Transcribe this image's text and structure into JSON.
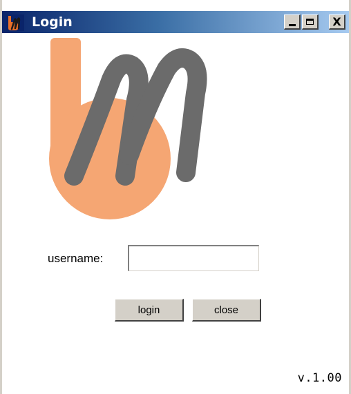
{
  "window": {
    "title": "Login",
    "minimize_glyph": "minimize-icon",
    "maximize_glyph": "maximize-icon",
    "close_glyph": "close-icon",
    "close_symbol": "X"
  },
  "logo": {
    "icon": "bm-logo-icon",
    "colors": {
      "orange": "#f5a673",
      "gray": "#6b6b6b"
    }
  },
  "form": {
    "username_label": "username:",
    "username_value": "",
    "username_placeholder": "",
    "login_label": "login",
    "close_label": "close"
  },
  "footer": {
    "version": "v.1.00"
  },
  "colors": {
    "titlebar_start": "#0a246a",
    "titlebar_end": "#a6caf0",
    "button_face": "#d4d0c8"
  }
}
